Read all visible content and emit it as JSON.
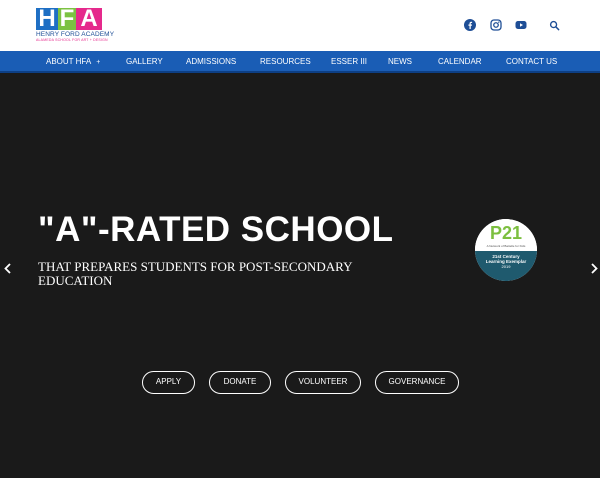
{
  "header": {
    "logo": {
      "letters": [
        "H",
        "F",
        "A"
      ],
      "name": "HENRY FORD ACADEMY",
      "sub": "ALAMEDA SCHOOL FOR ART + DESIGN"
    },
    "social_icons": [
      "facebook-icon",
      "instagram-icon",
      "youtube-icon",
      "search-icon"
    ]
  },
  "nav": {
    "items": [
      {
        "label": "ABOUT HFA",
        "has_dropdown": true
      },
      {
        "label": "GALLERY"
      },
      {
        "label": "ADMISSIONS"
      },
      {
        "label": "RESOURCES"
      },
      {
        "label": "ESSER III"
      },
      {
        "label": "NEWS"
      },
      {
        "label": "CALENDAR"
      },
      {
        "label": "CONTACT US"
      }
    ],
    "dropdown_glyph": "+"
  },
  "hero": {
    "title": "\"A\"-RATED SCHOOL",
    "subtitle": "THAT PREPARES STUDENTS FOR POST-SECONDARY EDUCATION",
    "badge": {
      "logo": "P21",
      "tag": "A Network of Battelle for Kids",
      "line1": "21st Century",
      "line2": "Learning Exemplar",
      "year": "2019"
    },
    "buttons": {
      "apply": "APPLY",
      "donate": "DONATE",
      "volunteer": "VOLUNTEER",
      "governance": "GOVERNANCE"
    }
  },
  "colors": {
    "nav_bg": "#1a5db5",
    "hero_bg": "#1a1a1a",
    "logo_h": "#1e6fc4",
    "logo_f": "#7cc242",
    "logo_a": "#e5298c",
    "icon": "#1e4e96"
  }
}
